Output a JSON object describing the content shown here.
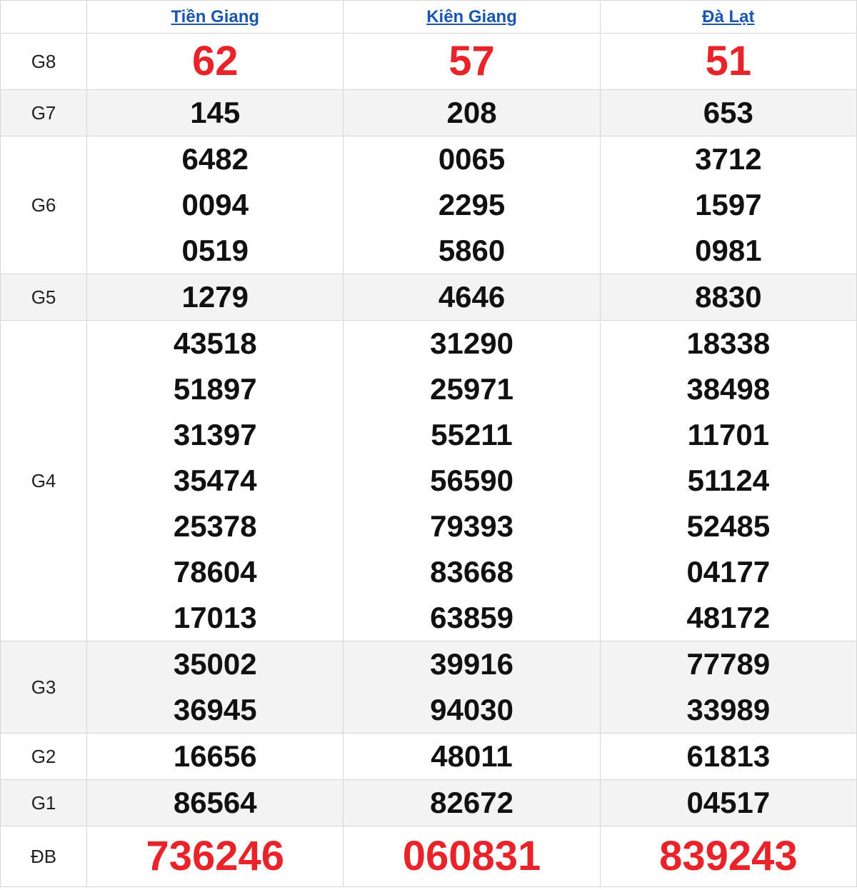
{
  "provinces": [
    "Tiền Giang",
    "Kiên Giang",
    "Đà Lạt"
  ],
  "prizes": [
    {
      "label": "G8",
      "style": "big",
      "alt": false,
      "values": [
        [
          "62"
        ],
        [
          "57"
        ],
        [
          "51"
        ]
      ]
    },
    {
      "label": "G7",
      "style": "normal",
      "alt": true,
      "values": [
        [
          "145"
        ],
        [
          "208"
        ],
        [
          "653"
        ]
      ]
    },
    {
      "label": "G6",
      "style": "normal",
      "alt": false,
      "values": [
        [
          "6482",
          "0094",
          "0519"
        ],
        [
          "0065",
          "2295",
          "5860"
        ],
        [
          "3712",
          "1597",
          "0981"
        ]
      ]
    },
    {
      "label": "G5",
      "style": "normal",
      "alt": true,
      "values": [
        [
          "1279"
        ],
        [
          "4646"
        ],
        [
          "8830"
        ]
      ]
    },
    {
      "label": "G4",
      "style": "normal",
      "alt": false,
      "values": [
        [
          "43518",
          "51897",
          "31397",
          "35474",
          "25378",
          "78604",
          "17013"
        ],
        [
          "31290",
          "25971",
          "55211",
          "56590",
          "79393",
          "83668",
          "63859"
        ],
        [
          "18338",
          "38498",
          "11701",
          "51124",
          "52485",
          "04177",
          "48172"
        ]
      ]
    },
    {
      "label": "G3",
      "style": "normal",
      "alt": true,
      "values": [
        [
          "35002",
          "36945"
        ],
        [
          "39916",
          "94030"
        ],
        [
          "77789",
          "33989"
        ]
      ]
    },
    {
      "label": "G2",
      "style": "normal",
      "alt": false,
      "values": [
        [
          "16656"
        ],
        [
          "48011"
        ],
        [
          "61813"
        ]
      ]
    },
    {
      "label": "G1",
      "style": "normal",
      "alt": true,
      "values": [
        [
          "86564"
        ],
        [
          "82672"
        ],
        [
          "04517"
        ]
      ]
    },
    {
      "label": "ĐB",
      "style": "special",
      "alt": false,
      "values": [
        [
          "736246"
        ],
        [
          "060831"
        ],
        [
          "839243"
        ]
      ]
    }
  ],
  "colors": {
    "link": "#1a56b0",
    "highlight": "#e8232a",
    "alt_row": "#f3f3f3"
  }
}
